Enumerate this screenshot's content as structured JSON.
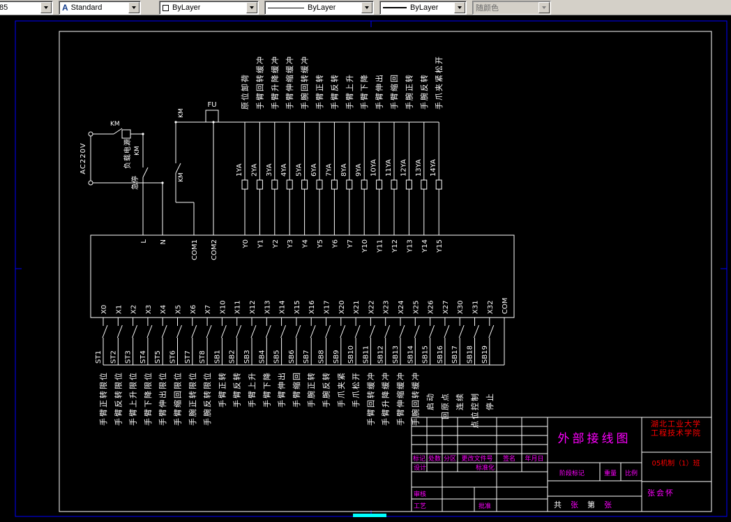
{
  "toolbar": {
    "layer_value": "85",
    "style_icon": "A",
    "style_value": "Standard",
    "color_value": "ByLayer",
    "linetype_value": "ByLayer",
    "lineweight_value": "ByLayer",
    "plotstyle_value": "随颜色"
  },
  "colors": {
    "line": "#ffffff",
    "paper": "#0000ff",
    "accent": "#00ffff",
    "label": "#ff00ff",
    "school": "#ff0000"
  },
  "schematic": {
    "power": {
      "source": "AC220V",
      "load": "负载电源",
      "estop": "急停",
      "contactor": "KM",
      "fuse": "FU"
    },
    "outputs": {
      "descriptions": [
        "原位卸荷",
        "手臂回转缓冲",
        "手臂升降缓冲",
        "手臂伸缩缓冲",
        "手腕回转缓冲",
        "手臂正转",
        "手臂反转",
        "手臂上升",
        "手臂下降",
        "手臂伸出",
        "手臂缩回",
        "手腕正转",
        "手腕反转",
        "手爪夹紧松开"
      ],
      "coils": [
        "1YA",
        "2YA",
        "3YA",
        "4YA",
        "5YA",
        "6YA",
        "7YA",
        "8YA",
        "9YA",
        "10YA",
        "11YA",
        "12YA",
        "13YA",
        "14YA"
      ],
      "top_terminals": [
        "L",
        "N",
        "COM1",
        "COM2",
        "Y0",
        "Y1",
        "Y2",
        "Y3",
        "Y4",
        "Y5",
        "Y6",
        "Y7",
        "Y10",
        "Y11",
        "Y12",
        "Y13",
        "Y14",
        "Y15"
      ]
    },
    "inputs": {
      "bottom_terminals": [
        "X0",
        "X1",
        "X2",
        "X3",
        "X4",
        "X5",
        "X6",
        "X7",
        "X10",
        "X11",
        "X12",
        "X13",
        "X14",
        "X15",
        "X16",
        "X17",
        "X20",
        "X21",
        "X22",
        "X23",
        "X24",
        "X25",
        "X26",
        "X27",
        "X30",
        "X31",
        "X32",
        "COM"
      ],
      "switches": [
        "ST1",
        "ST2",
        "ST3",
        "ST4",
        "ST5",
        "ST6",
        "ST7",
        "ST8",
        "SB1",
        "SB2",
        "SB3",
        "SB4",
        "SB5",
        "SB6",
        "SB7",
        "SB8",
        "SB9",
        "SB10",
        "SB11",
        "SB12",
        "SB13",
        "SB14",
        "SB15",
        "SB16",
        "SB17",
        "SB18",
        "SB19"
      ],
      "descriptions": [
        "手臂正转限位",
        "手臂反转限位",
        "手臂上升限位",
        "手臂下降限位",
        "手臂伸出限位",
        "手臂缩回限位",
        "手腕正转限位",
        "手腕反转限位",
        "手臂正转",
        "手臂反转",
        "手臂上升",
        "手臂下降",
        "手臂伸出",
        "手臂缩回",
        "手腕正转",
        "手腕反转",
        "手爪夹紧",
        "手爪松开",
        "手臂回转缓冲",
        "手臂升降缓冲",
        "手臂伸缩缓冲",
        "手腕回转缓冲",
        "启动",
        "回原点",
        "连续",
        "点位控制",
        "停止"
      ]
    }
  },
  "title_block": {
    "title": "外部接线图",
    "school": [
      "湖北工业大学",
      "工程技术学院"
    ],
    "class_name": "05机制（1）班",
    "author": "张会怀",
    "rev_headers": [
      "标记",
      "处数",
      "分区",
      "更改文件号",
      "签名",
      "年月日"
    ],
    "design": "设计",
    "standardize": "标准化",
    "stage": "阶段标记",
    "weight": "重量",
    "scale": "比例",
    "check": "审核",
    "process": "工艺",
    "approve": "批准",
    "sheet": [
      "共",
      "张",
      "第",
      "张"
    ]
  }
}
